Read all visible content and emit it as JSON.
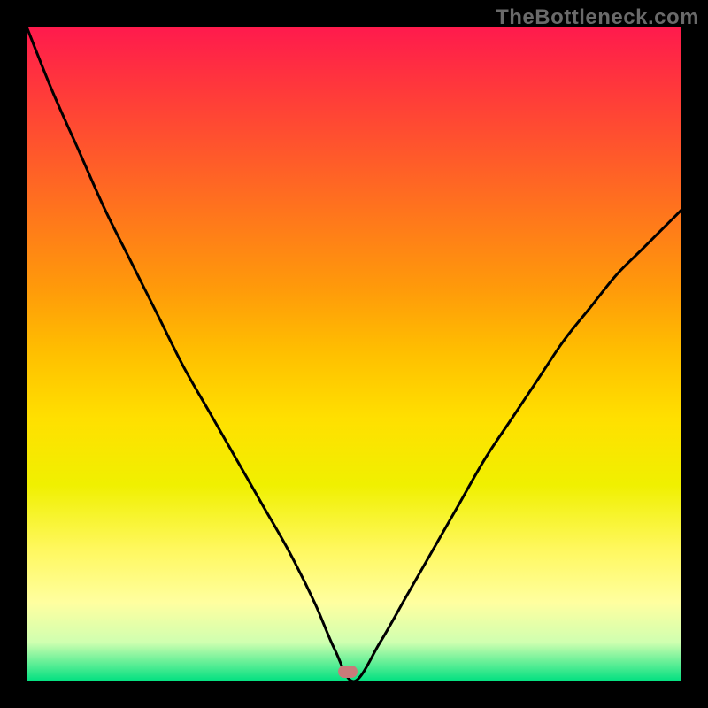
{
  "watermark": "TheBottleneck.com",
  "chart_data": {
    "type": "line",
    "title": "",
    "xlabel": "",
    "ylabel": "",
    "xlim": [
      0,
      100
    ],
    "ylim": [
      0,
      100
    ],
    "grid": false,
    "legend": false,
    "series": [
      {
        "name": "curve",
        "x_pct": [
          0,
          4,
          8,
          12,
          16,
          20,
          24,
          28,
          32,
          36,
          40,
          44,
          47,
          50,
          54,
          58,
          62,
          66,
          70,
          74,
          78,
          82,
          86,
          90,
          94,
          98,
          100
        ],
        "y_pct": [
          100,
          90,
          81,
          72,
          64,
          56,
          48,
          41,
          34,
          27,
          20,
          12,
          5,
          0,
          6,
          13,
          20,
          27,
          34,
          40,
          46,
          52,
          57,
          62,
          66,
          70,
          72
        ],
        "note": "y_pct is percent of plot height measured from the bottom (green) edge; x_pct is percent from left edge of the colored plot area"
      }
    ],
    "marker": {
      "x_pct": 49,
      "y_pct": 1.5
    },
    "colors": {
      "top": "#ff1a4d",
      "mid": "#ffe000",
      "bottom": "#00e080",
      "marker": "#c97a7a",
      "curve": "#000000",
      "frame": "#000000"
    }
  }
}
